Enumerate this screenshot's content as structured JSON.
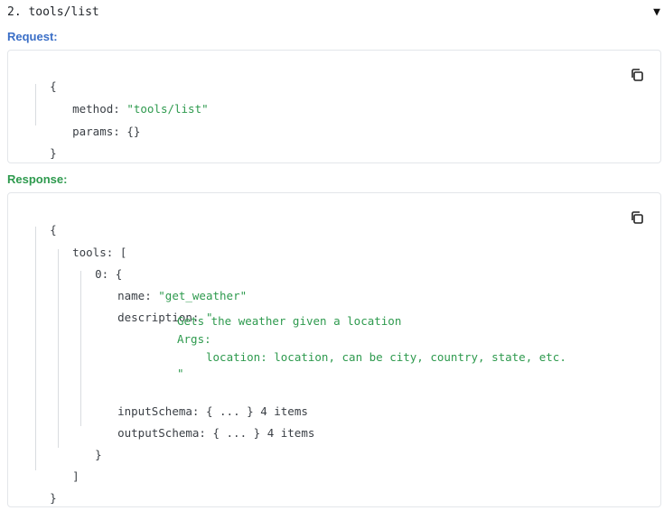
{
  "step": {
    "title": "2. tools/list",
    "collapse_icon": "▼"
  },
  "request": {
    "label": "Request:",
    "open": "{",
    "method_key": "method",
    "method_value": "\"tools/list\"",
    "params_key": "params",
    "params_value": "{}",
    "close": "}"
  },
  "response": {
    "label": "Response:",
    "open": "{",
    "tools_key": "tools",
    "tools_open": "[",
    "item_index": "0",
    "item_open": "{",
    "name_key": "name",
    "name_value": "\"get_weather\"",
    "description_key": "description",
    "description_open_quote": "\"",
    "description_line1": "Gets the weather given a location",
    "description_line2": "Args:",
    "description_line3": "location: location, can be city, country, state, etc.",
    "description_close_quote": "\"",
    "inputSchema_key": "inputSchema",
    "inputSchema_value": "{ ... }",
    "inputSchema_count": "4 items",
    "outputSchema_key": "outputSchema",
    "outputSchema_value": "{ ... }",
    "outputSchema_count": "4 items",
    "item_close": "}",
    "tools_close": "]",
    "close": "}"
  },
  "icons": {
    "copy": "copy-icon",
    "collapse": "triangle-down-icon"
  },
  "colors": {
    "request_label": "#3b6fc7",
    "response_label": "#2e9a4e",
    "string_value": "#2e9a4e",
    "panel_border": "#e3e6ea"
  }
}
